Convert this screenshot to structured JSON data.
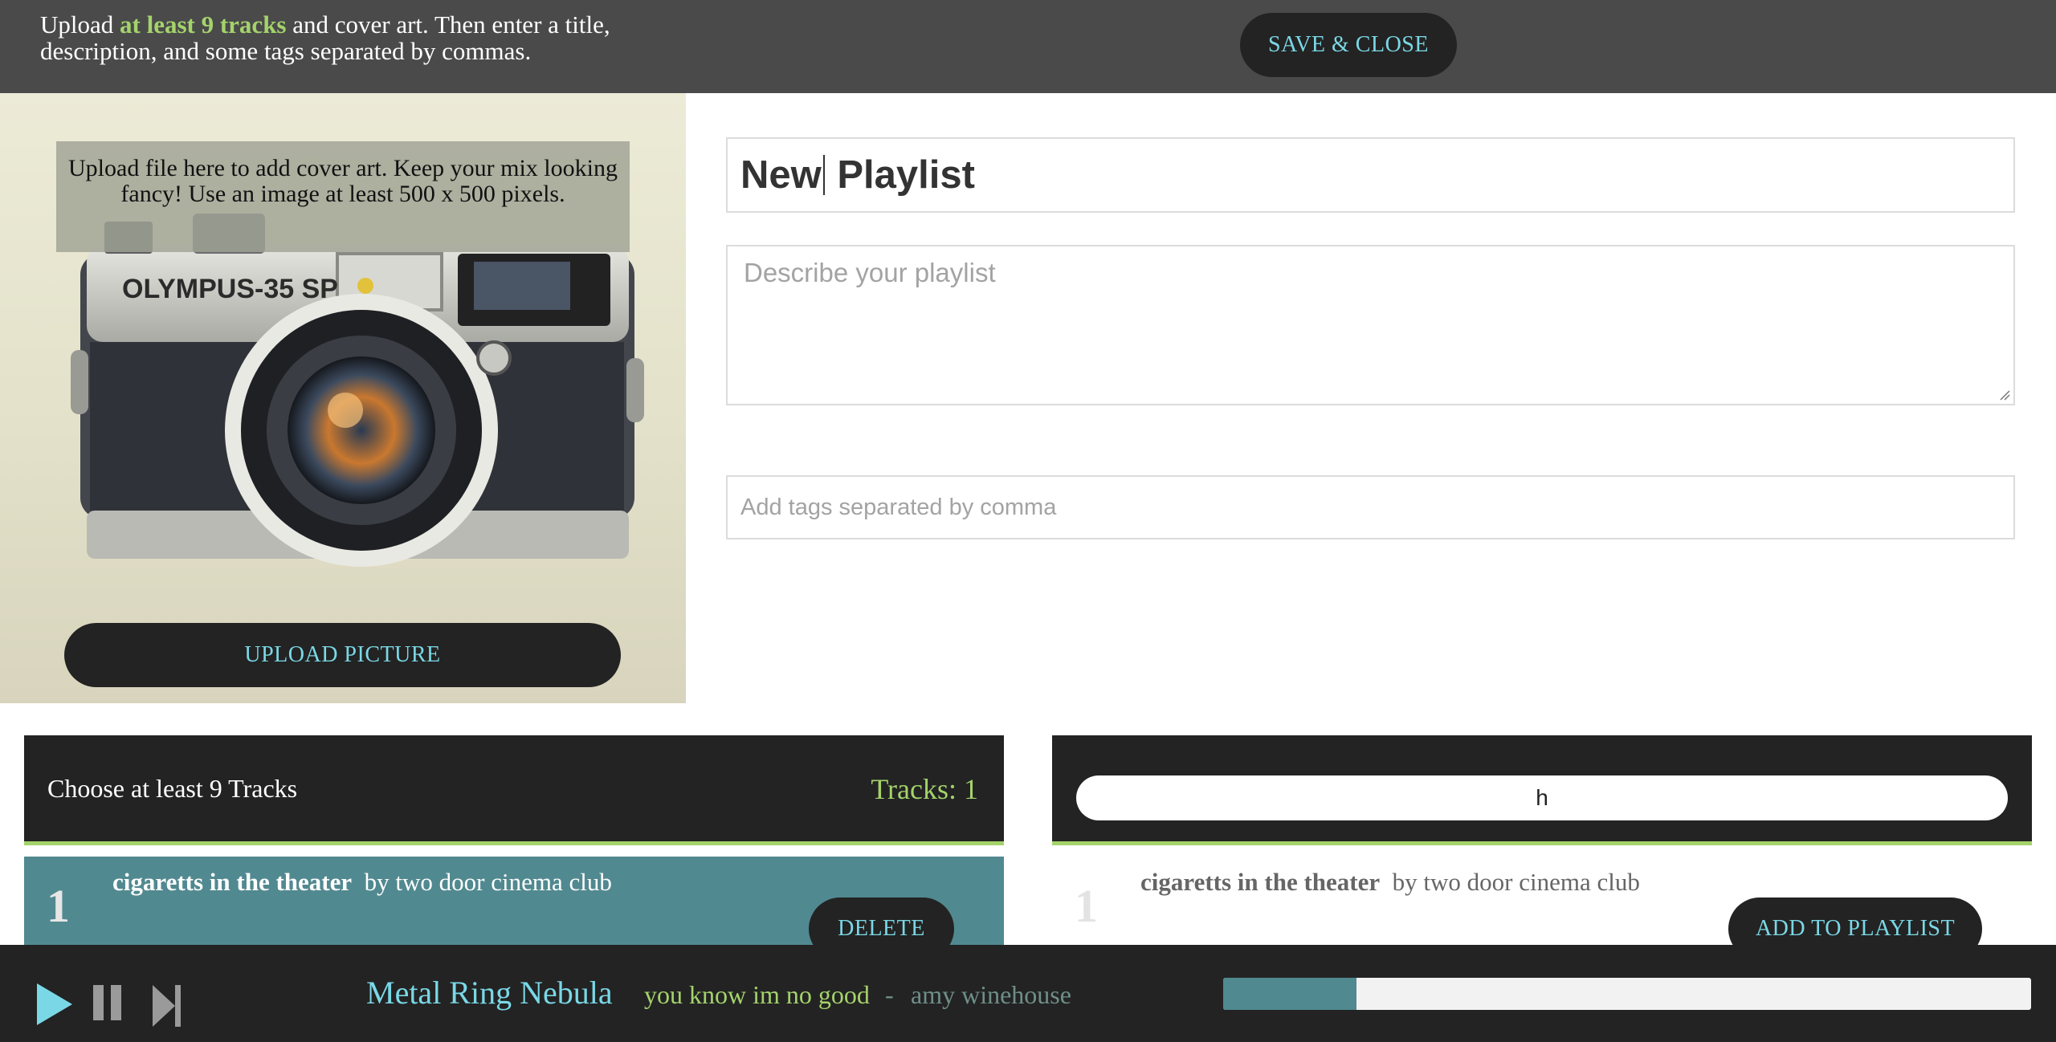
{
  "header": {
    "instructions_before": "Upload ",
    "instructions_highlight": "at least 9 tracks",
    "instructions_after": " and cover art. Then enter a title, description, and some tags separated by commas.",
    "save_label": "SAVE & CLOSE"
  },
  "cover": {
    "note": "Upload file here to add cover art. Keep your mix looking fancy! Use an image at least 500 x 500 pixels.",
    "upload_label": "UPLOAD PICTURE",
    "camera_brand": "OLYMPUS-35 SP"
  },
  "form": {
    "title_before_caret": "New",
    "title_after_caret": " Playlist",
    "description_placeholder": "Describe your playlist",
    "tags_placeholder": "Add tags separated by comma"
  },
  "playlist_panel": {
    "heading": "Choose at least 9 Tracks",
    "count_label": "Tracks: 1",
    "tracks": [
      {
        "number": "1",
        "title": "cigaretts in the theater",
        "by": "by two door cinema club",
        "action": "DELETE"
      }
    ]
  },
  "search_panel": {
    "query": "h",
    "results": [
      {
        "number": "1",
        "title": "cigaretts in the theater",
        "by": "by two door cinema club",
        "action": "ADD TO PLAYLIST"
      }
    ]
  },
  "player": {
    "station": "Metal Ring Nebula",
    "track": "you know im no good",
    "separator": "-",
    "artist": "amy winehouse",
    "progress_fraction": 0.165,
    "icons": [
      "play-icon",
      "pause-icon",
      "next-track-icon"
    ]
  },
  "colors": {
    "accent_blue": "#7ad8e6",
    "accent_green": "#a4d36b",
    "teal_row": "#518990",
    "dark": "#232323",
    "topbar": "#4a4a4a"
  }
}
